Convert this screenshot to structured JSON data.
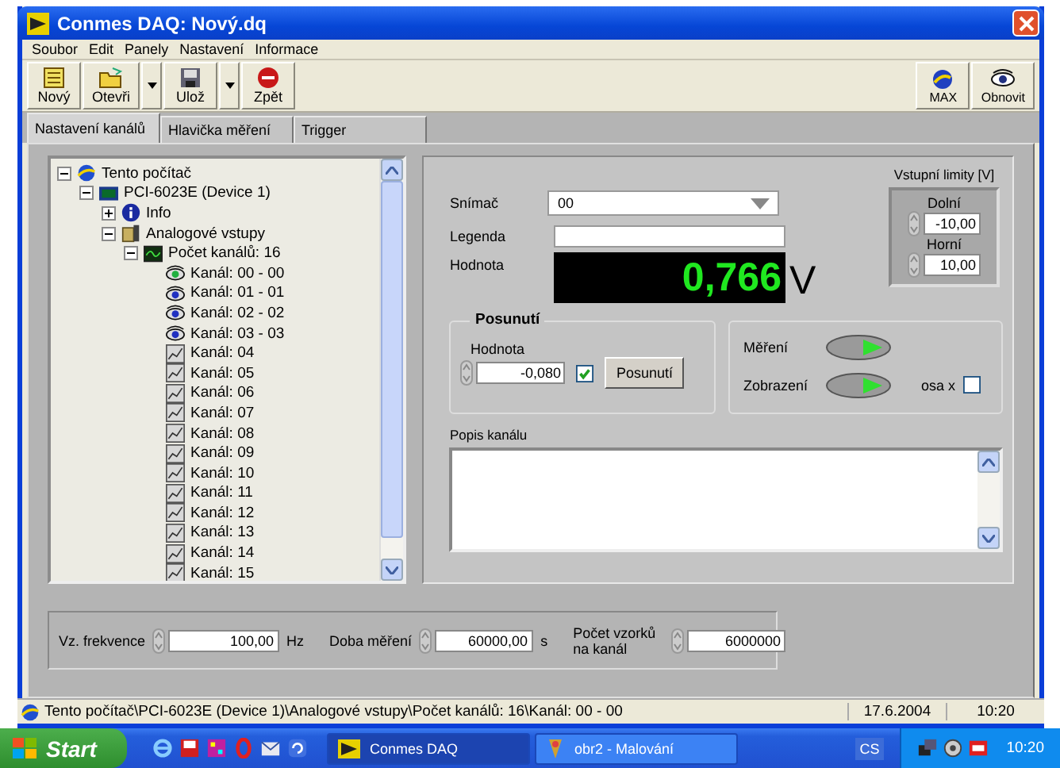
{
  "window": {
    "title": "Conmes DAQ: Nový.dq"
  },
  "menu": [
    "Soubor",
    "Edit",
    "Panely",
    "Nastavení",
    "Informace"
  ],
  "toolbar": {
    "left": [
      {
        "label": "Nový",
        "kind": "new",
        "dropdown": false
      },
      {
        "label": "Otevři",
        "kind": "open",
        "dropdown": true
      },
      {
        "label": "Ulož",
        "kind": "save",
        "dropdown": true
      },
      {
        "label": "Zpět",
        "kind": "stop",
        "dropdown": false
      }
    ],
    "right": [
      {
        "label": "MAX",
        "kind": "max",
        "dropdown": false
      },
      {
        "label": "Obnovit",
        "kind": "eye",
        "dropdown": false
      }
    ]
  },
  "tabs": [
    {
      "label": "Nastavení kanálů",
      "selected": true
    },
    {
      "label": "Hlavička měření",
      "selected": false
    },
    {
      "label": "Trigger",
      "selected": false
    }
  ],
  "tree": {
    "items": [
      {
        "label": "Tento počítač",
        "kind": "computer",
        "expanded": true,
        "children": [
          {
            "label": "PCI-6023E (Device 1)",
            "kind": "device",
            "expanded": true,
            "children": [
              {
                "label": "Info",
                "kind": "info",
                "expanded": false
              },
              {
                "label": "Analogové vstupy",
                "kind": "folder",
                "expanded": true,
                "children": [
                  {
                    "label": "Počet kanálů: 16",
                    "kind": "channels",
                    "expanded": true,
                    "children": [
                      {
                        "label": "Kanál: 00 - 00",
                        "kind": "eye",
                        "active": true
                      },
                      {
                        "label": "Kanál: 01 - 01",
                        "kind": "eye",
                        "active": false
                      },
                      {
                        "label": "Kanál: 02 - 02",
                        "kind": "eye",
                        "active": false
                      },
                      {
                        "label": "Kanál: 03 - 03",
                        "kind": "eye",
                        "active": false
                      },
                      {
                        "label": "Kanál: 04",
                        "kind": "chart"
                      },
                      {
                        "label": "Kanál: 05",
                        "kind": "chart"
                      },
                      {
                        "label": "Kanál: 06",
                        "kind": "chart"
                      },
                      {
                        "label": "Kanál: 07",
                        "kind": "chart"
                      },
                      {
                        "label": "Kanál: 08",
                        "kind": "chart"
                      },
                      {
                        "label": "Kanál: 09",
                        "kind": "chart"
                      },
                      {
                        "label": "Kanál: 10",
                        "kind": "chart"
                      },
                      {
                        "label": "Kanál: 11",
                        "kind": "chart"
                      },
                      {
                        "label": "Kanál: 12",
                        "kind": "chart"
                      },
                      {
                        "label": "Kanál: 13",
                        "kind": "chart"
                      },
                      {
                        "label": "Kanál: 14",
                        "kind": "chart"
                      },
                      {
                        "label": "Kanál: 15",
                        "kind": "chart"
                      }
                    ]
                  }
                ]
              }
            ]
          }
        ]
      }
    ]
  },
  "channel": {
    "sensor_label": "Snímač",
    "sensor_value": "00",
    "legend_label": "Legenda",
    "value_label": "Hodnota",
    "value": "0,766",
    "unit": "V",
    "limits": {
      "title": "Vstupní limity [V]",
      "low_label": "Dolní",
      "low": "-10,00",
      "high_label": "Horní",
      "high": "10,00"
    },
    "offset": {
      "title": "Posunutí",
      "label": "Hodnota",
      "value": "-0,080",
      "checked": true,
      "button": "Posunutí"
    },
    "switches": [
      {
        "label": "Měření",
        "on": true
      },
      {
        "label": "Zobrazení",
        "on": true
      }
    ],
    "axis": {
      "label": "osa x",
      "checked": false
    },
    "description_label": "Popis kanálu"
  },
  "measurement": [
    {
      "label": "Vz. frekvence",
      "value": "100,00",
      "unit": "Hz"
    },
    {
      "label": "Doba měření",
      "value": "60000,00",
      "unit": "s"
    },
    {
      "label": "Počet vzorků na kanál",
      "value": "6000000"
    }
  ],
  "status_bar": {
    "path": "Tento počítač\\PCI-6023E (Device 1)\\Analogové vstupy\\Počet kanálů: 16\\Kanál: 00 - 00",
    "date": "17.6.2004",
    "time": "10:20"
  },
  "taskbar": {
    "start": "Start",
    "tasks": [
      {
        "label": "Conmes DAQ",
        "selected": true
      },
      {
        "label": "obr2 - Malování",
        "selected": false
      }
    ],
    "language": "CS",
    "clock": "10:20"
  }
}
